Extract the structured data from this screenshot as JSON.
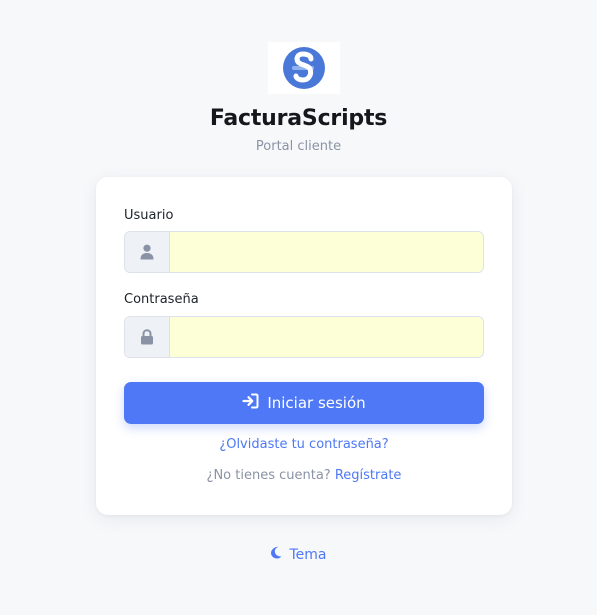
{
  "app": {
    "title": "FacturaScripts",
    "subtitle": "Portal cliente",
    "logo_icon": "facturascripts-logo-icon"
  },
  "form": {
    "username": {
      "label": "Usuario",
      "value": "",
      "icon": "user-icon"
    },
    "password": {
      "label": "Contraseña",
      "value": "",
      "icon": "lock-icon"
    },
    "submit_label": "Iniciar sesión",
    "submit_icon": "sign-in-icon",
    "forgot_password": "¿Olvidaste tu contraseña?",
    "no_account_text": "¿No tienes cuenta?",
    "register_link": "Regístrate"
  },
  "theme": {
    "label": "Tema",
    "icon": "moon-icon"
  },
  "colors": {
    "accent": "#4e78f5",
    "background": "#f7f8fa",
    "input_fill": "#fdffd6",
    "muted_text": "#8a93a5"
  }
}
